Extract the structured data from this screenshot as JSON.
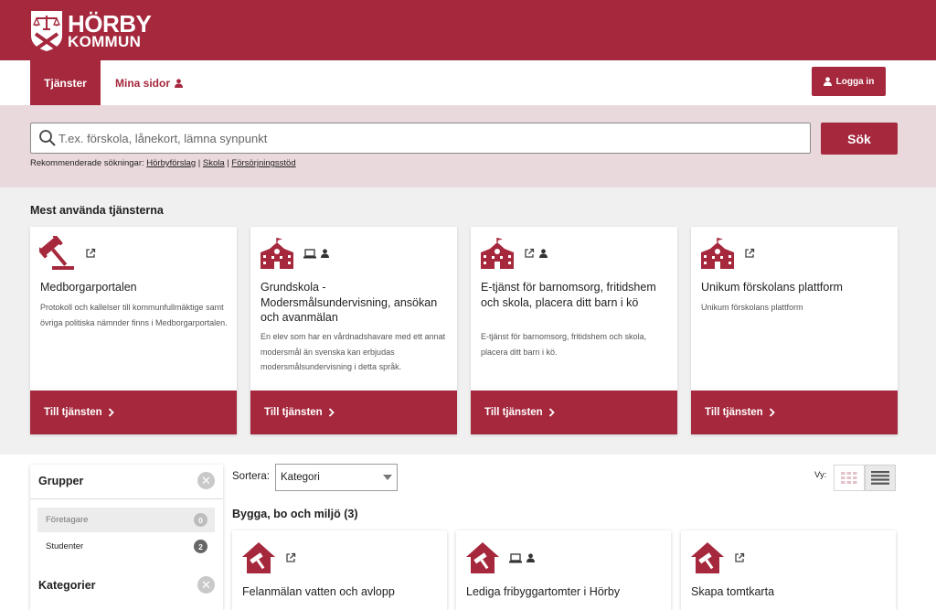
{
  "brand": {
    "name_line1": "HÖRBY",
    "name_line2": "KOMMUN",
    "color": "#a5283d"
  },
  "nav": {
    "active_tab": "Tjänster",
    "tab2": "Mina sidor",
    "login": "Logga in"
  },
  "search": {
    "placeholder": "T.ex. förskola, lånekort, lämna synpunkt",
    "button": "Sök",
    "recommended_label": "Rekommenderade sökningar:",
    "recommended": [
      "Hörbyförslag",
      "Skola",
      "Försörjningsstöd"
    ],
    "separator": "|"
  },
  "most_used": {
    "title": "Mest använda tjänsterna",
    "cards": [
      {
        "icon": "gavel-icon",
        "title": "Medborgarportalen",
        "desc": "Protokoll och kallelser till kommunfullmäktige samt övriga politiska nämnder finns i Medborgarportalen.",
        "cta": "Till tjänsten"
      },
      {
        "icon": "school-icon",
        "title": "Grundskola - Modersmålsundervisning, ansökan och avanmälan",
        "desc": "En elev som har en vårdnadshavare med ett annat modersmål än svenska kan erbjudas modersmålsundervisning i detta språk.",
        "cta": "Till tjänsten"
      },
      {
        "icon": "school-icon",
        "title": "E-tjänst för barnomsorg, fritidshem och skola, placera ditt barn i kö",
        "desc": "E-tjänst för barnomsorg, fritidshem och skola, placera ditt barn i kö.",
        "cta": "Till tjänsten"
      },
      {
        "icon": "school-icon",
        "title": "Unikum förskolans plattform",
        "desc": "Unikum förskolans plattform",
        "cta": "Till tjänsten"
      }
    ]
  },
  "filters": {
    "groups_title": "Grupper",
    "groups": [
      {
        "label": "Företagare",
        "count": "0"
      },
      {
        "label": "Studenter",
        "count": "2"
      }
    ],
    "categories_title": "Kategorier",
    "clear_symbol": "✕"
  },
  "listing": {
    "sort_label": "Sortera:",
    "sort_value": "Kategori",
    "view_label": "Vy:",
    "category_heading": "Bygga, bo och miljö (3)",
    "cards": [
      {
        "icon": "house-hammer-icon",
        "title": "Felanmälan vatten och avlopp"
      },
      {
        "icon": "house-hammer-icon",
        "title": "Lediga fribyggartomter i Hörby"
      },
      {
        "icon": "house-hammer-icon",
        "title": "Skapa tomtkarta"
      }
    ]
  }
}
